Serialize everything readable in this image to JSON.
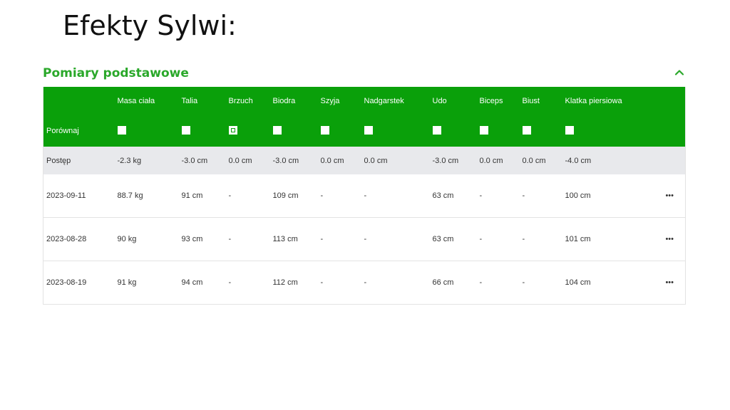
{
  "slide": {
    "title": "Efekty Sylwi:"
  },
  "section": {
    "title": "Pomiary podstawowe",
    "collapse_icon": "chevron-up-icon"
  },
  "colors": {
    "accent": "#0aa00a",
    "section_title": "#2aa82a",
    "progress_bg": "#e8e9ec"
  },
  "table": {
    "columns": [
      "Masa ciała",
      "Talia",
      "Brzuch",
      "Biodra",
      "Szyja",
      "Nadgarstek",
      "Udo",
      "Biceps",
      "Biust",
      "Klatka piersiowa"
    ],
    "compare": {
      "label": "Porównaj",
      "checked": [
        false,
        false,
        true,
        false,
        false,
        false,
        false,
        false,
        false,
        false
      ]
    },
    "progress": {
      "label": "Postęp",
      "values": [
        "-2.3 kg",
        "-3.0 cm",
        "0.0 cm",
        "-3.0 cm",
        "0.0 cm",
        "0.0 cm",
        "-3.0 cm",
        "0.0 cm",
        "0.0 cm",
        "-4.0 cm"
      ]
    },
    "rows": [
      {
        "date": "2023-09-11",
        "values": [
          "88.7 kg",
          "91 cm",
          "-",
          "109 cm",
          "-",
          "-",
          "63 cm",
          "-",
          "-",
          "100 cm"
        ],
        "menu": "•••"
      },
      {
        "date": "2023-08-28",
        "values": [
          "90 kg",
          "93 cm",
          "-",
          "113 cm",
          "-",
          "-",
          "63 cm",
          "-",
          "-",
          "101 cm"
        ],
        "menu": "•••"
      },
      {
        "date": "2023-08-19",
        "values": [
          "91 kg",
          "94 cm",
          "-",
          "112 cm",
          "-",
          "-",
          "66 cm",
          "-",
          "-",
          "104 cm"
        ],
        "menu": "•••"
      }
    ]
  }
}
